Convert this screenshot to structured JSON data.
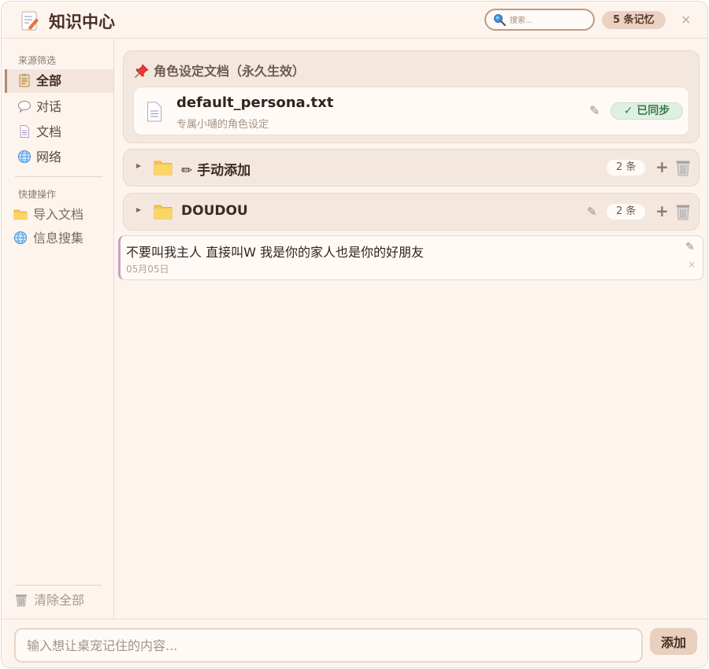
{
  "header": {
    "title": "知识中心",
    "search_placeholder": "搜索...",
    "memory_count": "5 条记忆",
    "close": "×"
  },
  "sidebar": {
    "source_filter_label": "来源筛选",
    "filters": [
      {
        "label": "全部",
        "icon": "clipboard-icon",
        "active": true
      },
      {
        "label": "对话",
        "icon": "speech-bubble-icon",
        "active": false
      },
      {
        "label": "文档",
        "icon": "document-icon",
        "active": false
      },
      {
        "label": "网络",
        "icon": "globe-icon",
        "active": false
      }
    ],
    "quick_actions_label": "快捷操作",
    "actions": [
      {
        "label": "导入文档",
        "icon": "folder-icon"
      },
      {
        "label": "信息搜集",
        "icon": "globe-icon"
      }
    ],
    "clear_all": "清除全部"
  },
  "persona": {
    "title": "角色设定文档（永久生效）",
    "file_name": "default_persona.txt",
    "file_desc": "专属小嗵的角色设定",
    "sync_status": "✓ 已同步"
  },
  "groups": [
    {
      "name": "✏ 手动添加",
      "count": "2 条",
      "editable": false
    },
    {
      "name": "DOUDOU",
      "count": "2 条",
      "editable": true
    }
  ],
  "memory_item": {
    "text": "不要叫我主人 直接叫W 我是你的家人也是你的好朋友",
    "date": "05月05日"
  },
  "footer": {
    "input_placeholder": "输入想让桌宠记住的内容...",
    "add_label": "添加"
  },
  "colors": {
    "background": "#fdf4ee",
    "accent": "#e8cfbe",
    "sync_green": "#3c7a4c",
    "folder_yellow": "#f7c548"
  }
}
